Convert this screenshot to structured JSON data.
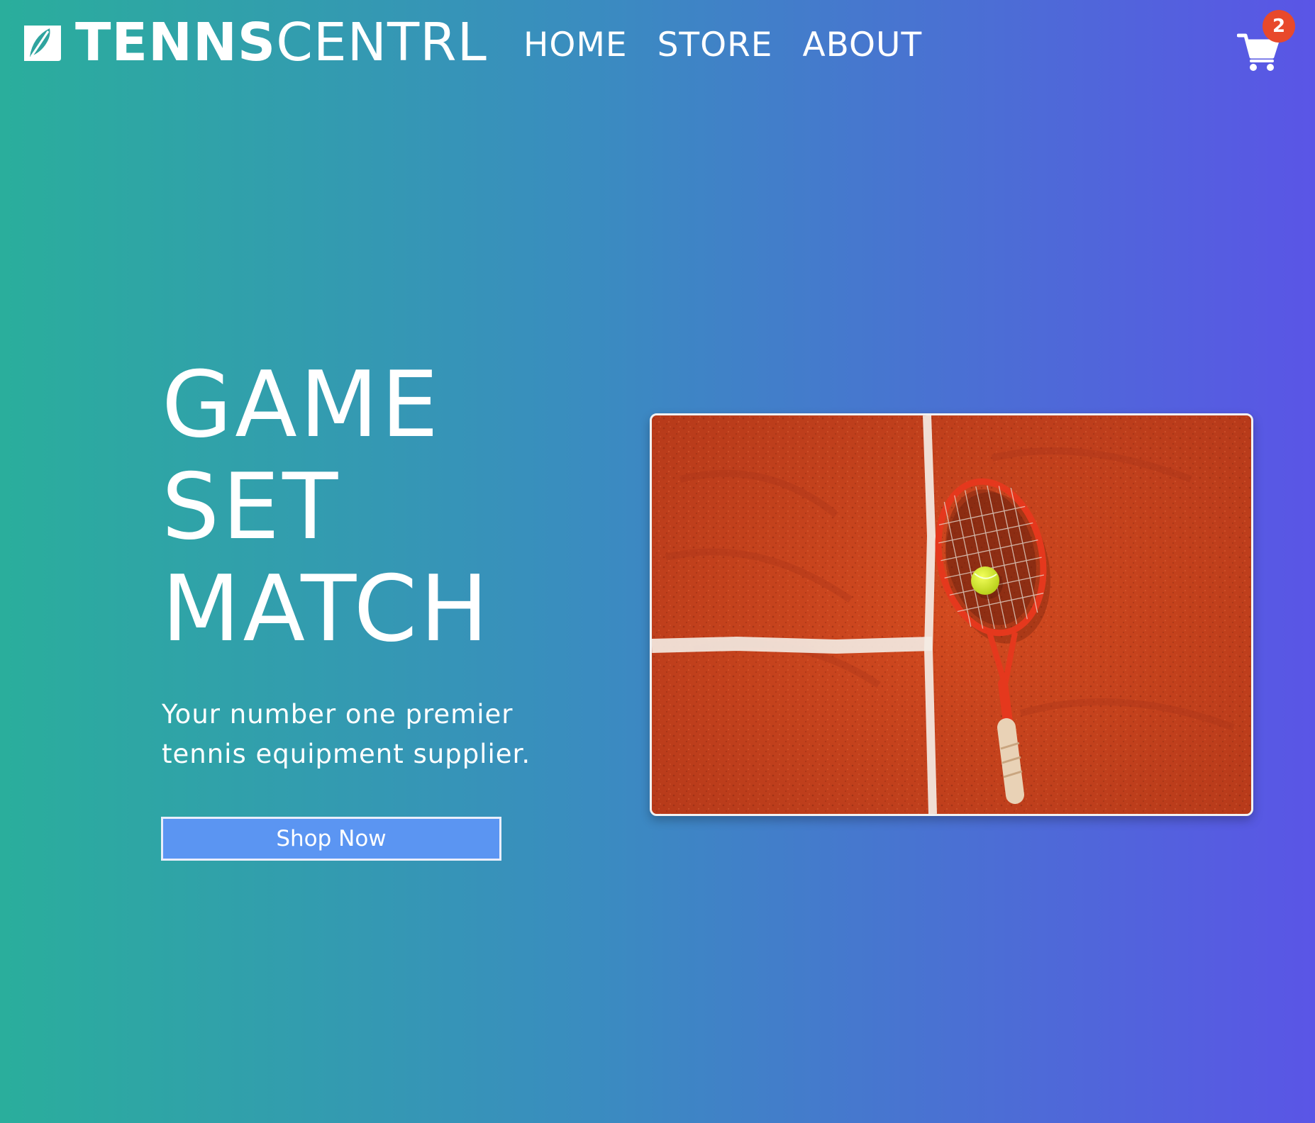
{
  "brand": {
    "name_bold": "TENNS",
    "name_light": "CENTRL",
    "logo_icon": "leaf-logo-icon"
  },
  "nav": {
    "items": [
      {
        "label": "HOME"
      },
      {
        "label": "STORE"
      },
      {
        "label": "ABOUT"
      }
    ]
  },
  "cart": {
    "icon": "shopping-cart-icon",
    "count": "2",
    "badge_color": "#e8492b"
  },
  "hero": {
    "title_lines": [
      "GAME",
      "SET",
      "MATCH"
    ],
    "subtitle": "Your number one premier tennis equipment supplier.",
    "cta_label": "Shop Now",
    "image": "tennis-racket-clay-court-photo"
  },
  "colors": {
    "gradient_start": "#2aae9c",
    "gradient_end": "#5a55e6",
    "cta_background": "#5b95f2",
    "clay": "#c5411b"
  }
}
